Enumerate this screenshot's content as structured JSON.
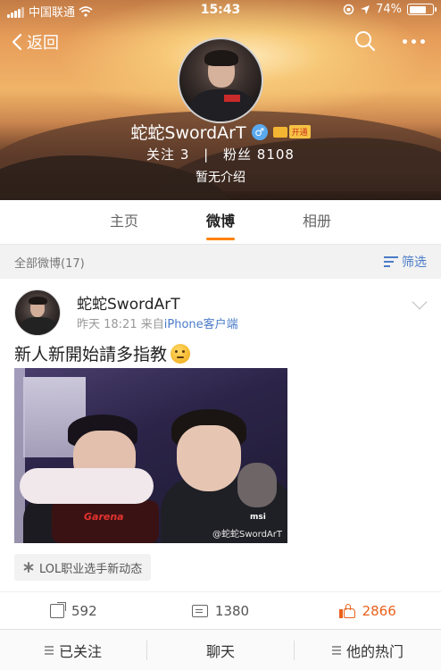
{
  "status_bar": {
    "carrier": "中国联通",
    "time": "15:43",
    "battery": "74%",
    "battery_level": 0.74
  },
  "nav": {
    "back_label": "返回",
    "back_icon": "chevron-left-icon",
    "search_icon": "search-icon",
    "more_icon": "more-dots-icon"
  },
  "profile": {
    "name": "蛇蛇SwordArT",
    "gender_symbol": "♂",
    "vip_tag": "开通",
    "following_label": "关注",
    "following_count": "3",
    "separator": "|",
    "followers_label": "粉丝",
    "followers_count": "8108",
    "intro": "暂无介绍"
  },
  "tabs": [
    {
      "label": "主页",
      "active": false
    },
    {
      "label": "微博",
      "active": true
    },
    {
      "label": "相册",
      "active": false
    }
  ],
  "filter_bar": {
    "all_posts": "全部微博(17)",
    "filter_label": "筛选"
  },
  "post": {
    "author": "蛇蛇SwordArT",
    "time": "昨天 18:21",
    "source_prefix": "来自",
    "source": "iPhone客户端",
    "text": "新人新開始請多指教",
    "image_logo": "Garena",
    "image_brand": "msi",
    "image_watermark": "@蛇蛇SwordArT",
    "topic": "LOL职业选手新动态",
    "shares": "592",
    "comments": "1380",
    "likes": "2866"
  },
  "bottom_bar": {
    "followed": "已关注",
    "chat": "聊天",
    "hot": "他的热门"
  },
  "colors": {
    "accent": "#ff8200",
    "link": "#4a7cc8",
    "like": "#e8611c"
  }
}
